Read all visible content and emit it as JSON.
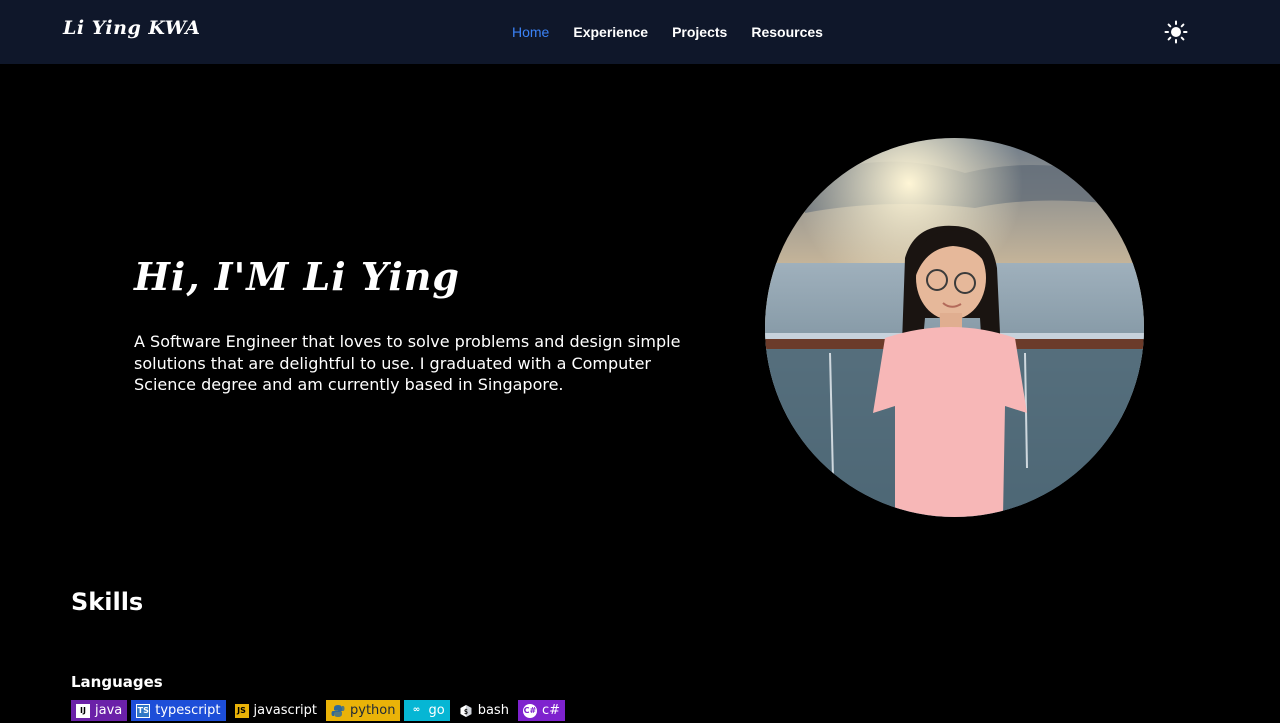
{
  "nav": {
    "brand": "Li Ying KWA",
    "links": [
      {
        "label": "Home",
        "active": true
      },
      {
        "label": "Experience",
        "active": false
      },
      {
        "label": "Projects",
        "active": false
      },
      {
        "label": "Resources",
        "active": false
      }
    ],
    "theme_icon": "sun-icon"
  },
  "hero": {
    "title": "Hi, I'M Li Ying",
    "description": "A Software Engineer that loves to solve problems and design simple solutions that are delightful to use. I graduated with a Computer Science degree and am currently based in Singapore.",
    "portrait_icon": "portrait-photo"
  },
  "skills": {
    "title": "Skills",
    "languages_title": "Languages",
    "languages": [
      {
        "label": "java",
        "icon": "intellij-icon",
        "color": "#6b21a8"
      },
      {
        "label": "typescript",
        "icon": "typescript-icon",
        "color": "#1d4ed8"
      },
      {
        "label": "javascript",
        "icon": "javascript-icon",
        "color": "#000000"
      },
      {
        "label": "python",
        "icon": "python-icon",
        "color": "#eab308"
      },
      {
        "label": "go",
        "icon": "go-icon",
        "color": "#06b6d4"
      },
      {
        "label": "bash",
        "icon": "bash-icon",
        "color": "#000000"
      },
      {
        "label": "c#",
        "icon": "csharp-icon",
        "color": "#7e22ce"
      }
    ]
  },
  "colors": {
    "navbar_bg": "#0f172a",
    "accent": "#3b82f6",
    "page_bg": "#000000"
  }
}
